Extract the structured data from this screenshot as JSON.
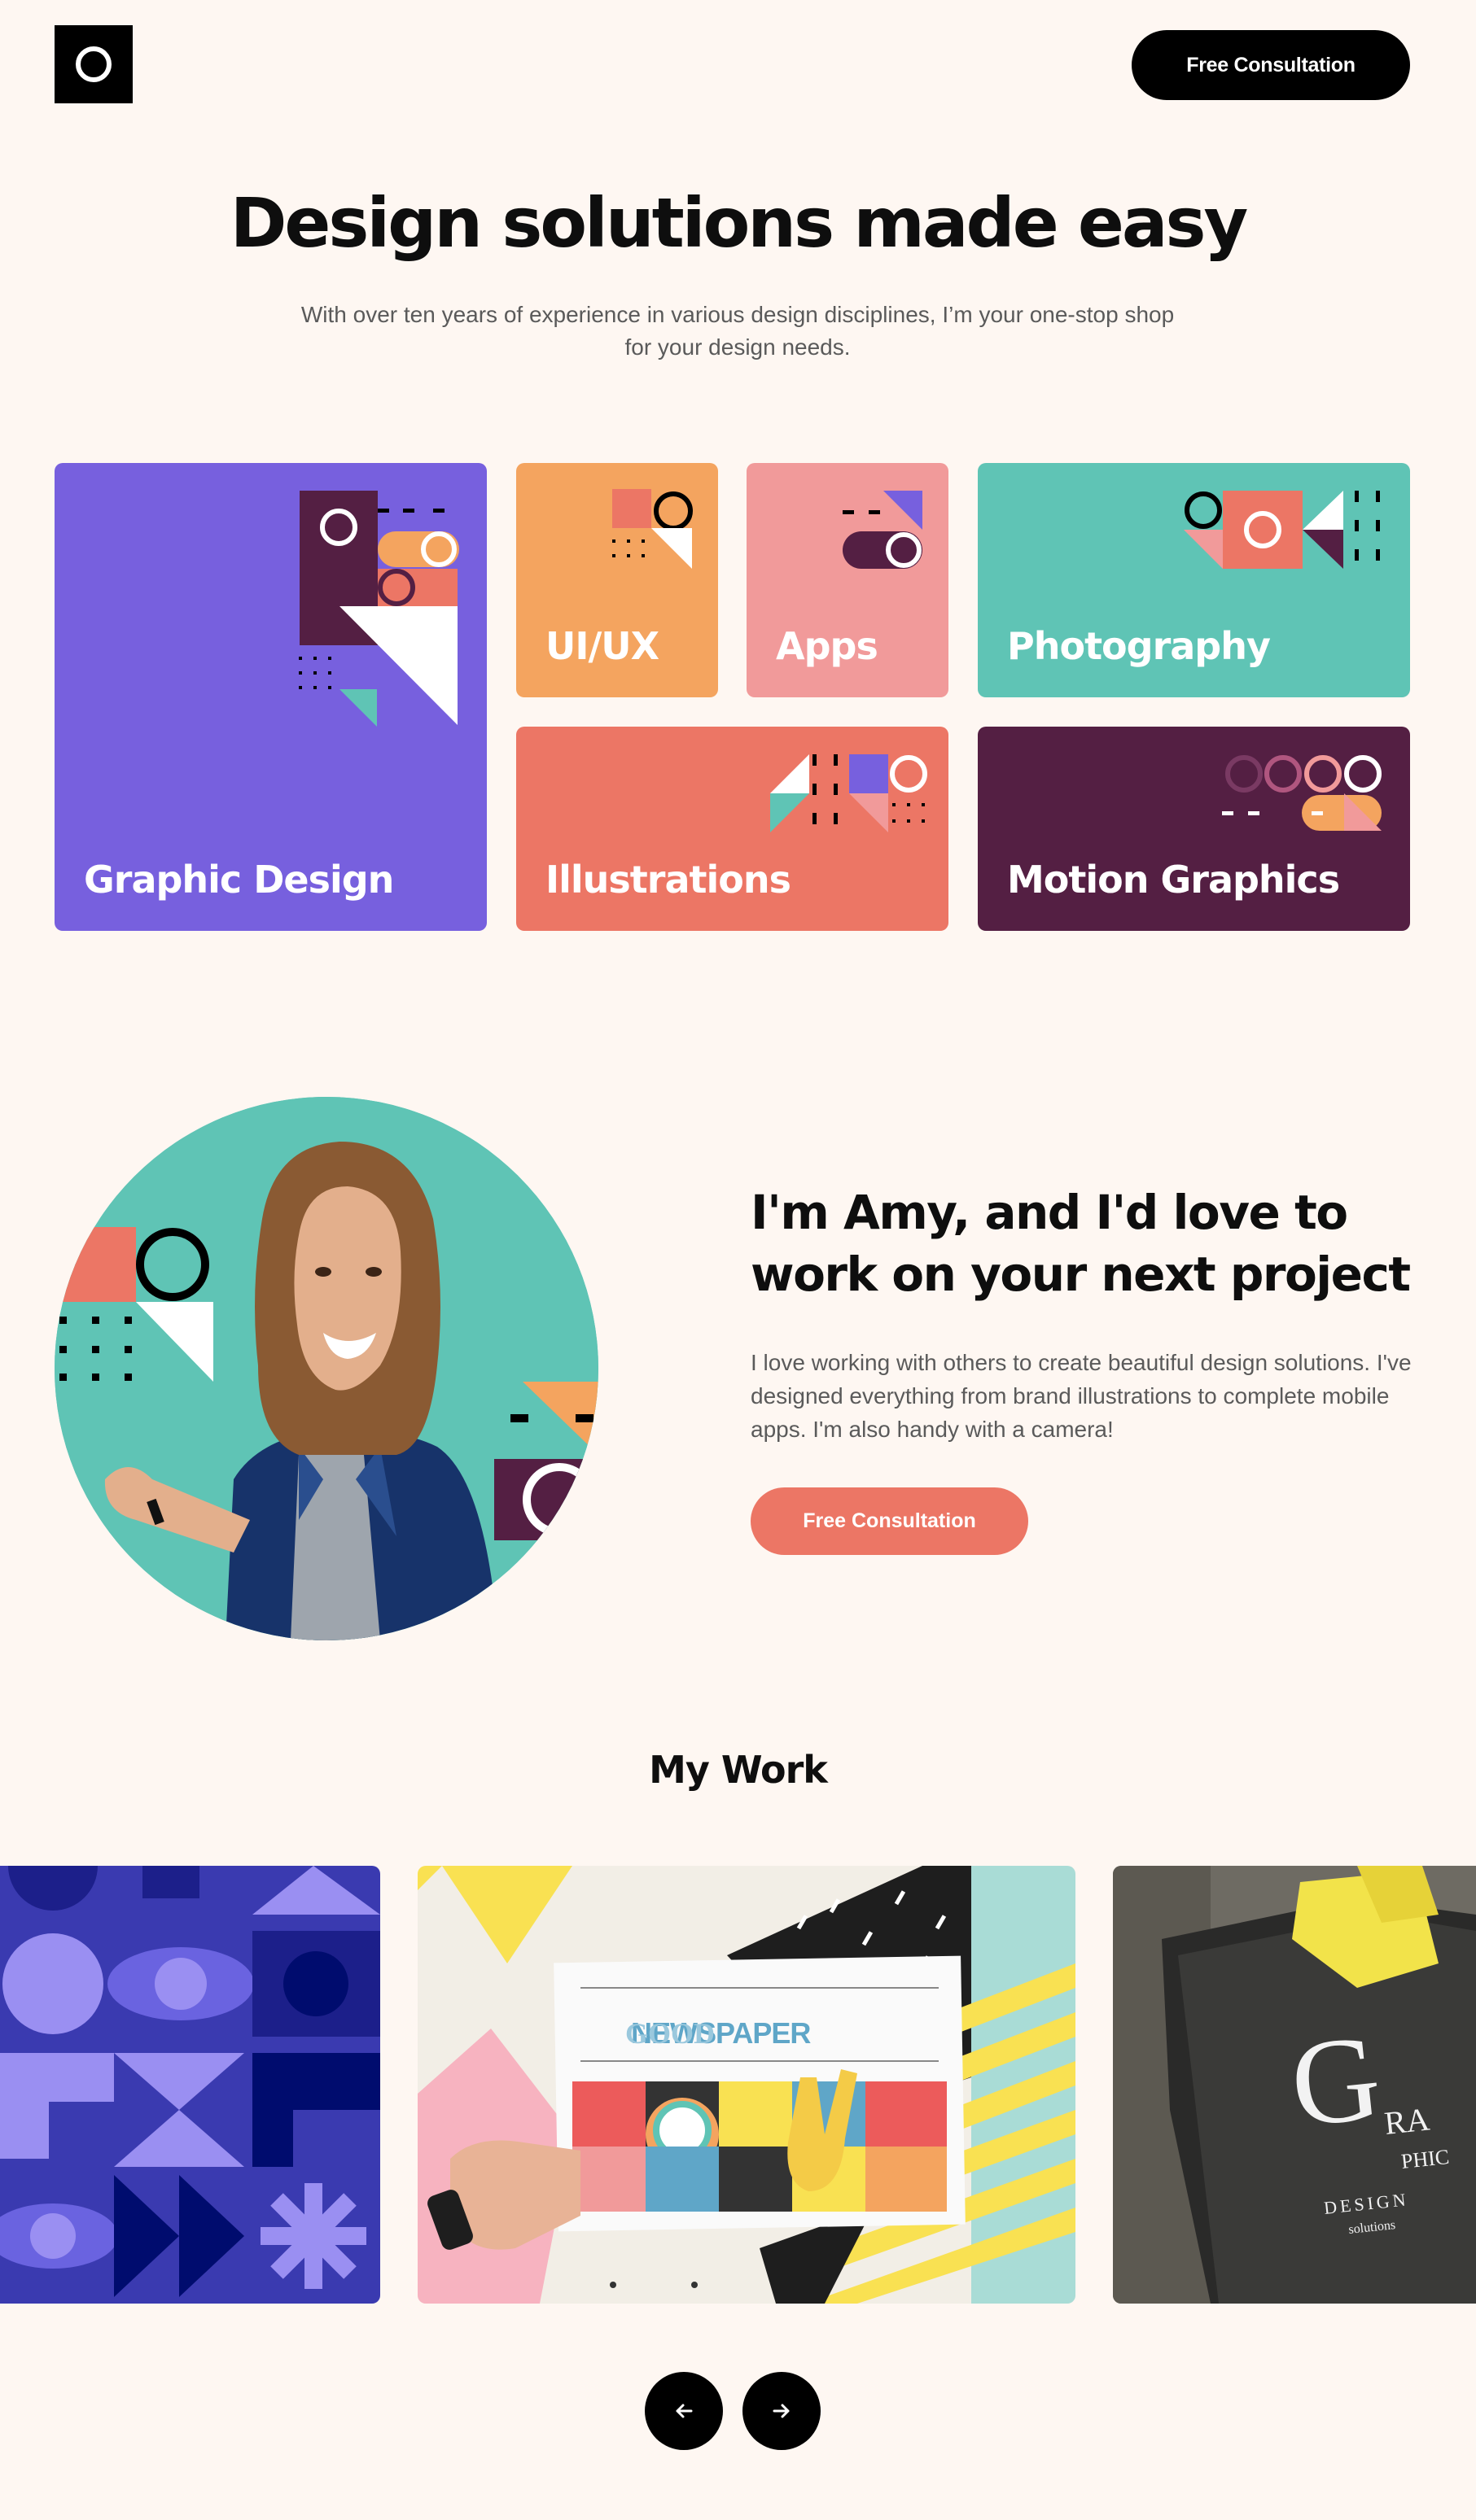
{
  "header": {
    "logo_name": "ring-logo",
    "cta_label": "Free Consultation"
  },
  "hero": {
    "title": "Design solutions made easy",
    "subtitle": "With over ten years of experience in various design disciplines, I’m your one-stop shop for your design needs."
  },
  "services": [
    {
      "label": "Graphic Design",
      "color": "#7760DE"
    },
    {
      "label": "UI/UX",
      "color": "#F4A45F"
    },
    {
      "label": "Apps",
      "color": "#F19A9A"
    },
    {
      "label": "Photography",
      "color": "#5FC4B5"
    },
    {
      "label": "Illustrations",
      "color": "#EC7665"
    },
    {
      "label": "Motion Graphics",
      "color": "#541F43"
    }
  ],
  "about": {
    "title": "I'm Amy, and I'd love to work on your next project",
    "text": "I love working with others to create beautiful design solutions. I've designed everything from brand illustrations to complete mobile apps. I'm also handy with a camera!",
    "cta_label": "Free Consultation"
  },
  "work": {
    "title": "My Work",
    "items": [
      {
        "name": "geometric-pattern-artwork"
      },
      {
        "name": "good-newspaper-artwork",
        "masthead": "NEWSPAPER"
      },
      {
        "name": "graphic-design-book-artwork",
        "cover_text": "GRAPHIC DESIGN solutions"
      }
    ]
  },
  "carousel": {
    "prev_icon": "arrow-left-icon",
    "next_icon": "arrow-right-icon"
  },
  "colors": {
    "background": "#FEF7F2",
    "purple": "#7760DE",
    "orange": "#F4A45F",
    "pink": "#F19A9A",
    "teal": "#5FC4B5",
    "coral": "#EC7665",
    "plum": "#541F43"
  }
}
